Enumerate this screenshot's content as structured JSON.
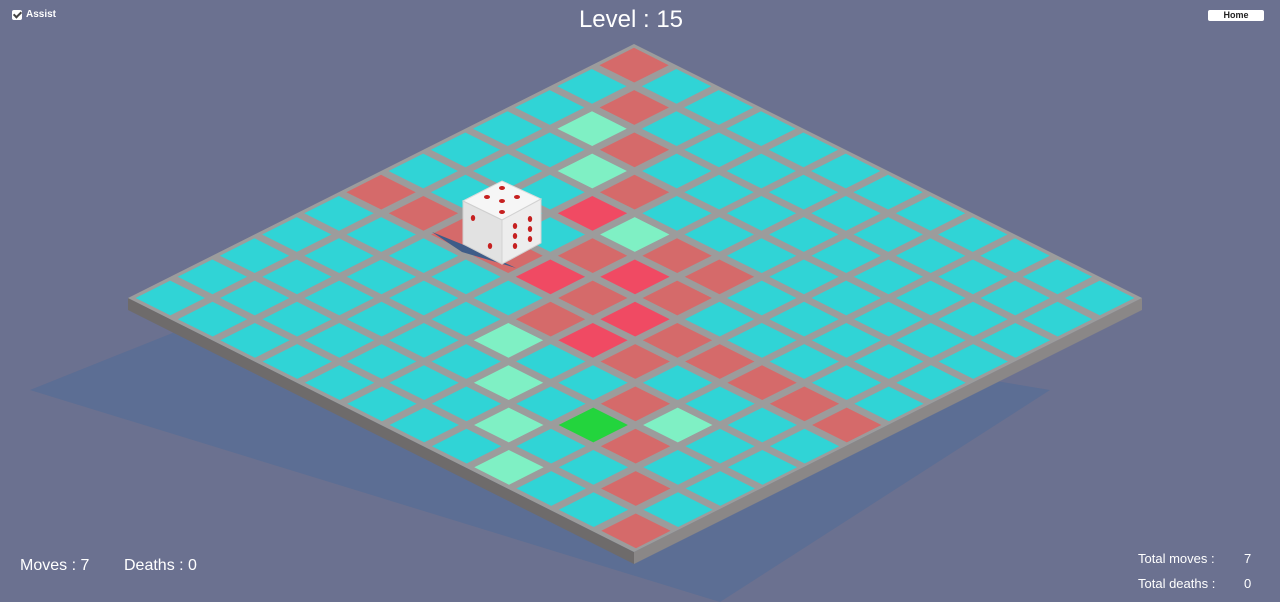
{
  "hud": {
    "assist_label": "Assist",
    "assist_checked": true,
    "level_text": "Level : 15",
    "home_label": "Home",
    "moves_text": "Moves : 7",
    "deaths_text": "Deaths : 0",
    "total_moves_label": "Total moves :",
    "total_moves_value": "7",
    "total_deaths_label": "Total deaths :",
    "total_deaths_value": "0"
  },
  "colors": {
    "background": "#6b7190",
    "board_shadow": "#5c6e94",
    "board_top": "#9c9c9c",
    "board_side_left": "#6e6b6b",
    "board_side_right": "#8a8787",
    "tile_normal": "#30d4d6",
    "tile_trail": "#d56a6a",
    "tile_bright_red": "#f04a63",
    "tile_assist": "#7ff0c4",
    "tile_goal": "#23d43d",
    "die_face": "#f2f2f2",
    "die_pip": "#c62020"
  },
  "board": {
    "rows": 12,
    "cols": 12,
    "cells": [
      "000000000000",
      "000000000000",
      "000000000000",
      "000000000000",
      "000000000000",
      "000000000000",
      "000000000000",
      "000000000000",
      "000000000000",
      "000000000000",
      "000000000000",
      "000000000000"
    ]
  },
  "die": {
    "top_face_pips": 5,
    "left_face_pips": 2,
    "right_face_pips": 6
  }
}
